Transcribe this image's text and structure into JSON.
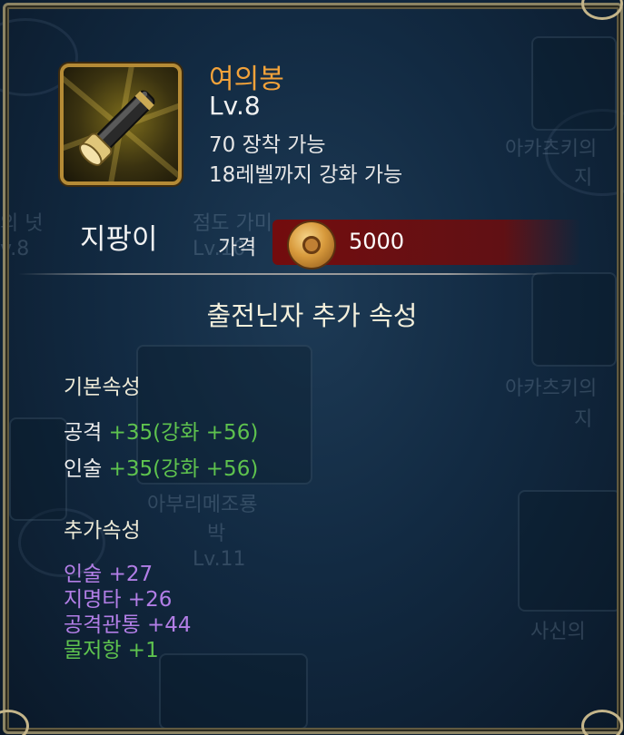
{
  "item": {
    "name": "여의봉",
    "level": "Lv.8",
    "equip_req": "70 장착 가능",
    "upgrade_req": "18레벨까지 강화 가능",
    "category": "지팡이"
  },
  "price": {
    "label": "가격",
    "value": "5000"
  },
  "section_title": "출전닌자 추가 속성",
  "base_attrs": {
    "heading": "기본속성",
    "rows": [
      {
        "key": "공격",
        "value": "+35(강화 +56)"
      },
      {
        "key": "인술",
        "value": "+35(강화 +56)"
      }
    ]
  },
  "extra_attrs": {
    "heading": "추가속성",
    "rows": [
      {
        "text": "인술 +27",
        "color": "#b27ee6"
      },
      {
        "text": "지명타 +26",
        "color": "#b27ee6"
      },
      {
        "text": "공격관통 +44",
        "color": "#b27ee6"
      },
      {
        "text": "물저항 +1",
        "color": "#5ec24e"
      }
    ]
  },
  "background": {
    "labels": [
      "의 넛",
      "v.8",
      "점도 가미",
      "Lv.10",
      "아카츠키의",
      "지",
      "아카츠키의",
      "지",
      "아부리메조룡",
      "박",
      "Lv.11",
      "사신의"
    ]
  },
  "colors": {
    "title": "#f2a23a",
    "bonus_green": "#5ec24e",
    "bonus_purple": "#b27ee6",
    "frame_gold": "#b58b36"
  }
}
